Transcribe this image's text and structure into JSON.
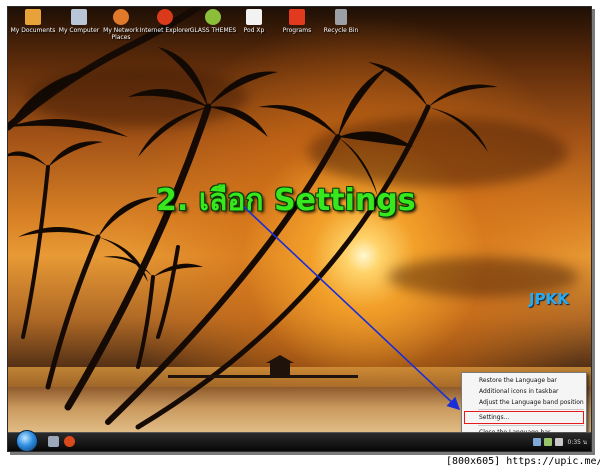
{
  "desktop": {
    "icons": [
      {
        "label": "My Documents",
        "icon": "my-documents-icon",
        "color": "#e8a23a"
      },
      {
        "label": "My Computer",
        "icon": "my-computer-icon",
        "color": "#b8c6d8"
      },
      {
        "label": "My Network Places",
        "icon": "network-places-icon",
        "color": "#e07a2a"
      },
      {
        "label": "Internet Explorer",
        "icon": "internet-explorer-icon",
        "color": "#d83a1a"
      },
      {
        "label": "GLASS THEMES",
        "icon": "glass-themes-icon",
        "color": "#8bbf3a"
      },
      {
        "label": "Pod Xp",
        "icon": "pod-xp-icon",
        "color": "#f2f2f2"
      },
      {
        "label": "Programs",
        "icon": "programs-icon",
        "color": "#e23a1f"
      },
      {
        "label": "Recycle Bin",
        "icon": "recycle-bin-icon",
        "color": "#9aa0a6"
      }
    ]
  },
  "overlay": {
    "instruction": "2. เลือก Settings",
    "watermark": "JPKK",
    "text_color": "#38e81e",
    "arrow_color": "#1a2fd8"
  },
  "context_menu": {
    "items": [
      {
        "label": "Restore the Language bar"
      },
      {
        "label": "Additional icons in taskbar"
      },
      {
        "label": "Adjust the Language band position"
      },
      {
        "label": "Settings...",
        "highlighted": true
      },
      {
        "label": "Close the Language bar"
      }
    ],
    "highlight_color": "#e61a1a"
  },
  "taskbar": {
    "clock": "0:35 น"
  },
  "caption": {
    "text": "[800x605] https://upic.me/"
  }
}
